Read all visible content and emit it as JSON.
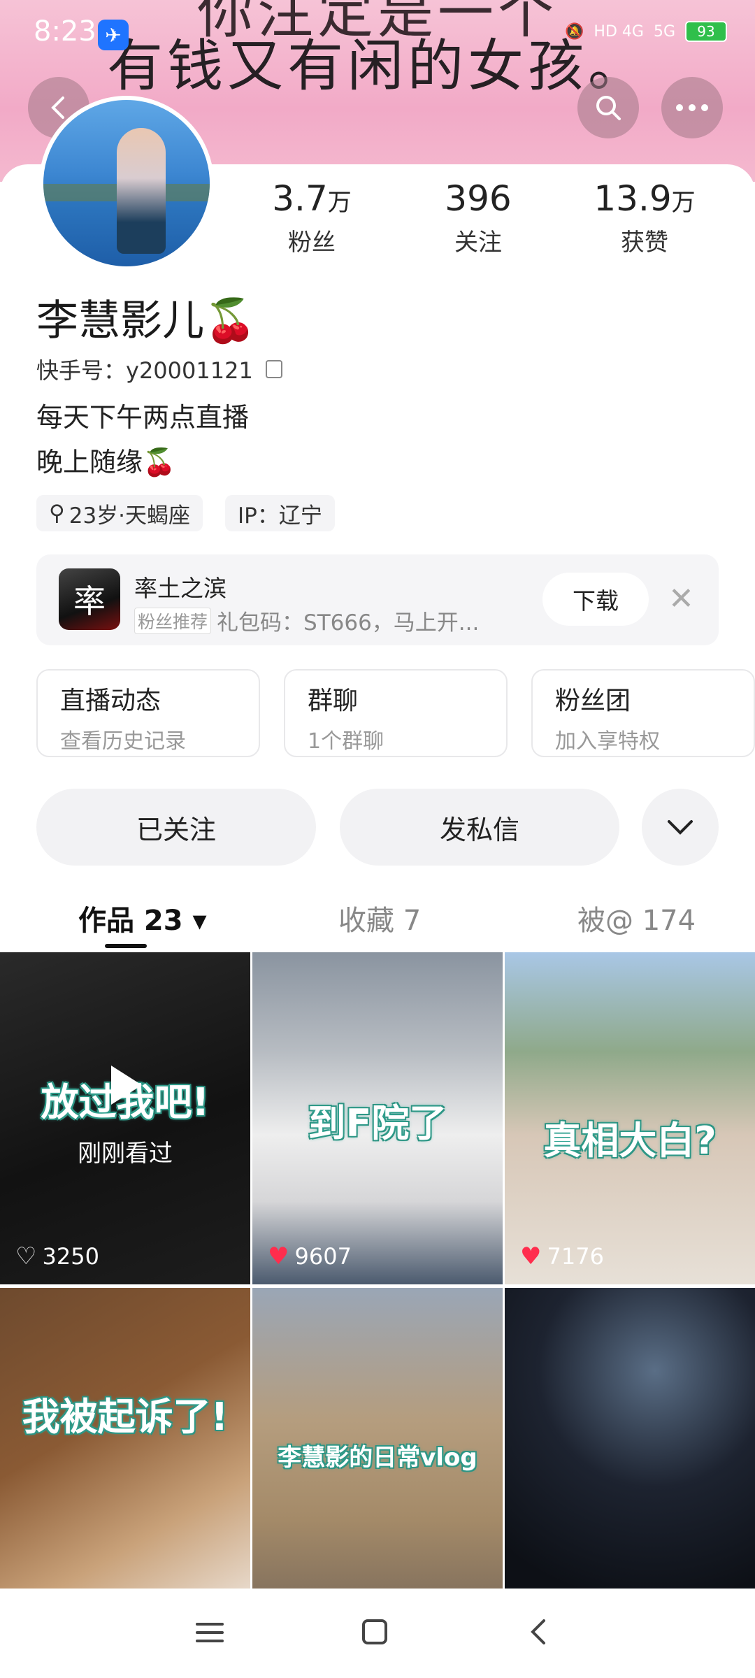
{
  "banner": {
    "line1": "你注定是一个",
    "line2": "有钱又有闲的女孩。"
  },
  "status": {
    "time": "8:23",
    "signal1": "HD 4G",
    "signal2": "5G",
    "battery": "93"
  },
  "profile": {
    "stats": [
      {
        "num": "3.7",
        "unit": "万",
        "label": "粉丝"
      },
      {
        "num": "396",
        "unit": "",
        "label": "关注"
      },
      {
        "num": "13.9",
        "unit": "万",
        "label": "获赞"
      }
    ],
    "name": "李慧影儿🍒",
    "kuaishou_id": "快手号：y20001121",
    "bio_line1": "每天下午两点直播",
    "bio_line2": "晚上随缘🍒",
    "tag_age": "23岁·天蝎座",
    "tag_ip": "IP：辽宁"
  },
  "promo": {
    "logo_text": "率",
    "title": "率土之滨",
    "badge": "粉丝推荐",
    "subtitle": "礼包码：ST666，马上开...",
    "download_label": "下载"
  },
  "features": [
    {
      "title": "直播动态",
      "sub": "查看历史记录"
    },
    {
      "title": "群聊",
      "sub": "1个群聊"
    },
    {
      "title": "粉丝团",
      "sub": "加入享特权"
    }
  ],
  "actions": {
    "followed": "已关注",
    "message": "发私信"
  },
  "tabs": [
    {
      "label": "作品 23 ▾"
    },
    {
      "label": "收藏 7"
    },
    {
      "label": "被@ 174"
    }
  ],
  "videos": [
    {
      "title": "放过我吧!",
      "likes": "3250",
      "seen": "刚刚看过"
    },
    {
      "title": "到F院了",
      "likes": "9607"
    },
    {
      "title": "真相大白?",
      "likes": "7176"
    },
    {
      "title": "我被起诉了!",
      "likes": ""
    },
    {
      "title": "李慧影的日常vlog",
      "likes": ""
    },
    {
      "title": "",
      "likes": ""
    }
  ]
}
